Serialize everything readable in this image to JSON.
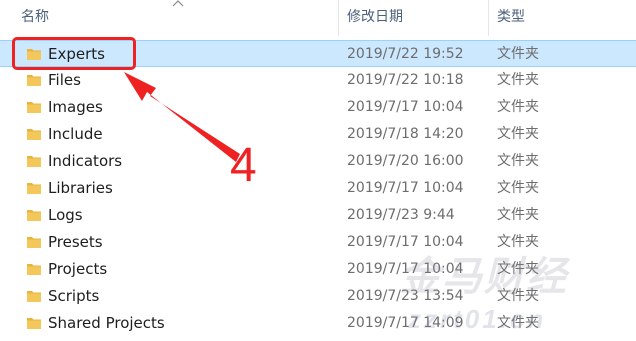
{
  "columns": {
    "name": "名称",
    "date_modified": "修改日期",
    "type": "类型"
  },
  "files": [
    {
      "name": "Experts",
      "date": "2019/7/22 19:52",
      "type": "文件夹"
    },
    {
      "name": "Files",
      "date": "2019/7/22 10:18",
      "type": "文件夹"
    },
    {
      "name": "Images",
      "date": "2019/7/17 10:04",
      "type": "文件夹"
    },
    {
      "name": "Include",
      "date": "2019/7/18 14:20",
      "type": "文件夹"
    },
    {
      "name": "Indicators",
      "date": "2019/7/20 16:00",
      "type": "文件夹"
    },
    {
      "name": "Libraries",
      "date": "2019/7/17 10:04",
      "type": "文件夹"
    },
    {
      "name": "Logs",
      "date": "2019/7/23 9:44",
      "type": "文件夹"
    },
    {
      "name": "Presets",
      "date": "2019/7/17 10:04",
      "type": "文件夹"
    },
    {
      "name": "Projects",
      "date": "2019/7/17 10:04",
      "type": "文件夹"
    },
    {
      "name": "Scripts",
      "date": "2019/7/23 13:54",
      "type": "文件夹"
    },
    {
      "name": "Shared Projects",
      "date": "2019/7/17 14:09",
      "type": "文件夹"
    }
  ],
  "selected_index": 0,
  "annotation": {
    "step_number": "4",
    "color": "#ee2222"
  },
  "watermark": {
    "text": "金马财经",
    "sub": "zzrt01.cn"
  },
  "icons": {
    "folder": "folder-icon",
    "sort": "sort-caret-icon"
  },
  "colors": {
    "folder_fill": "#f3c75a",
    "selection_bg": "#cce8ff",
    "header_text": "#4c607a"
  }
}
